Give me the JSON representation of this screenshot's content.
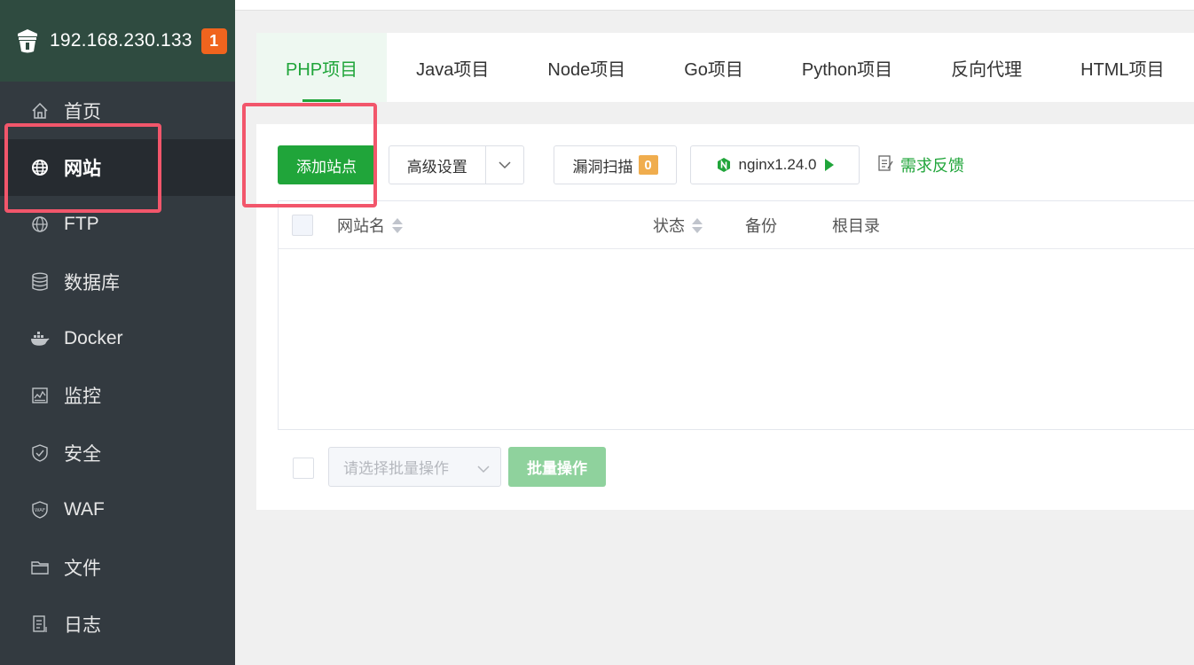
{
  "sidebar": {
    "server_ip": "192.168.230.133",
    "notification_count": "1",
    "items": [
      {
        "label": "首页",
        "icon": "home-icon"
      },
      {
        "label": "网站",
        "icon": "globe-icon",
        "active": true
      },
      {
        "label": "FTP",
        "icon": "ftp-globe-icon"
      },
      {
        "label": "数据库",
        "icon": "database-icon"
      },
      {
        "label": "Docker",
        "icon": "docker-icon"
      },
      {
        "label": "监控",
        "icon": "monitor-icon"
      },
      {
        "label": "安全",
        "icon": "shield-icon"
      },
      {
        "label": "WAF",
        "icon": "waf-shield-icon"
      },
      {
        "label": "文件",
        "icon": "folder-icon"
      },
      {
        "label": "日志",
        "icon": "log-icon"
      }
    ]
  },
  "tabs": [
    {
      "label": "PHP项目",
      "active": true
    },
    {
      "label": "Java项目"
    },
    {
      "label": "Node项目"
    },
    {
      "label": "Go项目"
    },
    {
      "label": "Python项目"
    },
    {
      "label": "反向代理"
    },
    {
      "label": "HTML项目"
    }
  ],
  "toolbar": {
    "add_site": "添加站点",
    "advanced_settings": "高级设置",
    "vuln_scan": "漏洞扫描",
    "vuln_count": "0",
    "nginx_version": "nginx1.24.0",
    "feedback": "需求反馈"
  },
  "table": {
    "columns": {
      "site_name": "网站名",
      "status": "状态",
      "backup": "备份",
      "root_dir": "根目录"
    },
    "rows": []
  },
  "batch": {
    "select_placeholder": "请选择批量操作",
    "action": "批量操作"
  },
  "colors": {
    "accent": "#20a53a",
    "sidebar_bg": "#333a40",
    "highlight": "#f2566b",
    "badge": "#f0641e"
  }
}
